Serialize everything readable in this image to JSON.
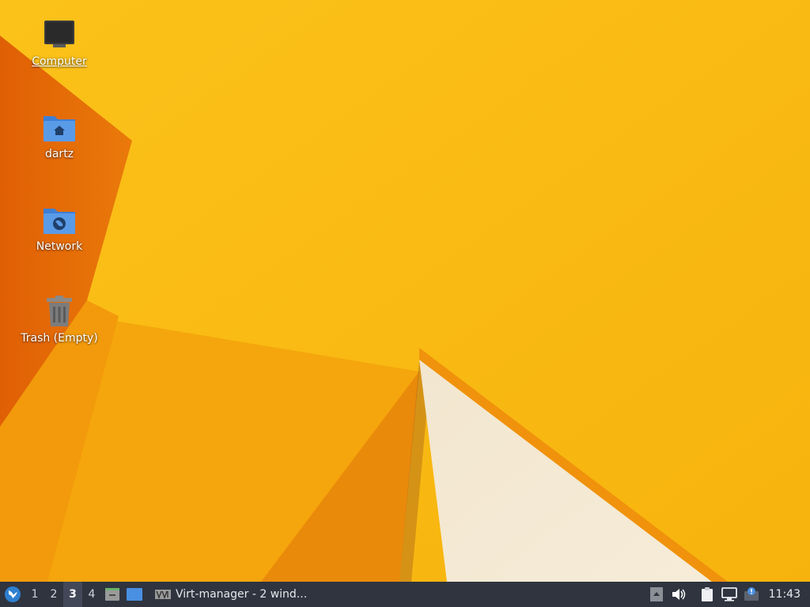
{
  "desktop": {
    "icons": [
      {
        "label": "Computer",
        "icon": "computer-icon",
        "selected": true
      },
      {
        "label": "dartz",
        "icon": "home-folder-icon"
      },
      {
        "label": "Network",
        "icon": "network-folder-icon"
      },
      {
        "label": "Trash (Empty)",
        "icon": "trash-icon"
      }
    ]
  },
  "taskbar": {
    "workspaces": [
      "1",
      "2",
      "3",
      "4"
    ],
    "active_workspace": "3",
    "launchers": [
      "file-manager-icon",
      "show-desktop-icon"
    ],
    "task_label": "Virt-manager - 2 wind...",
    "tray_icons": [
      "tray-arrow-icon",
      "volume-icon",
      "clipboard-icon",
      "network-status-icon",
      "update-notifier-icon"
    ],
    "clock": "11:43"
  },
  "colors": {
    "wallpaper_base": "#f9b90c",
    "wallpaper_orange": "#e8720a",
    "taskbar_bg": "#2f343f",
    "folder_blue": "#4a8fe0"
  }
}
